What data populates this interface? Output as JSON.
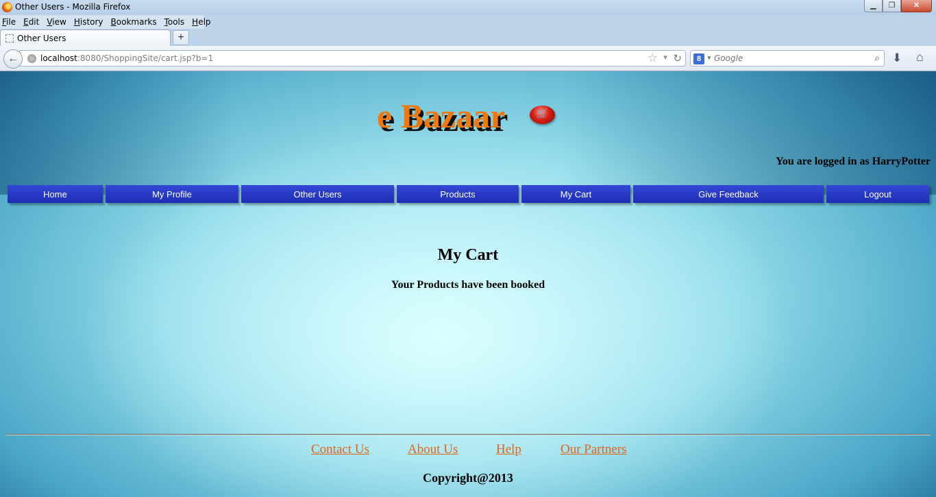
{
  "browser": {
    "window_title": "Other Users - Mozilla Firefox",
    "menu": [
      "File",
      "Edit",
      "View",
      "History",
      "Bookmarks",
      "Tools",
      "Help"
    ],
    "tab_label": "Other Users",
    "new_tab": "+",
    "url_host": "localhost",
    "url_rest": ":8080/ShoppingSite/cart.jsp?b=1",
    "search_placeholder": "Google",
    "search_engine_icon": "8",
    "window_buttons": {
      "minimize": "▁",
      "maximize": "❐",
      "close": "✕"
    }
  },
  "site": {
    "logo_text": "e Bazaar",
    "logo_icon": "🛒",
    "login_status": "You are logged in as HarryPotter",
    "nav": [
      {
        "label": "Home"
      },
      {
        "label": "My Profile"
      },
      {
        "label": "Other Users"
      },
      {
        "label": "Products"
      },
      {
        "label": "My Cart"
      },
      {
        "label": "Give Feedback"
      },
      {
        "label": "Logout"
      }
    ],
    "colors": {
      "nav_bg": "#2436c4",
      "logo": "#f0780c",
      "footer_link": "#e0641a"
    }
  },
  "main": {
    "title": "My Cart",
    "message": "Your Products have been booked"
  },
  "footer": {
    "links": [
      {
        "label": "Contact Us"
      },
      {
        "label": "About Us"
      },
      {
        "label": "Help"
      },
      {
        "label": "Our Partners"
      }
    ],
    "copyright": "Copyright@2013"
  }
}
